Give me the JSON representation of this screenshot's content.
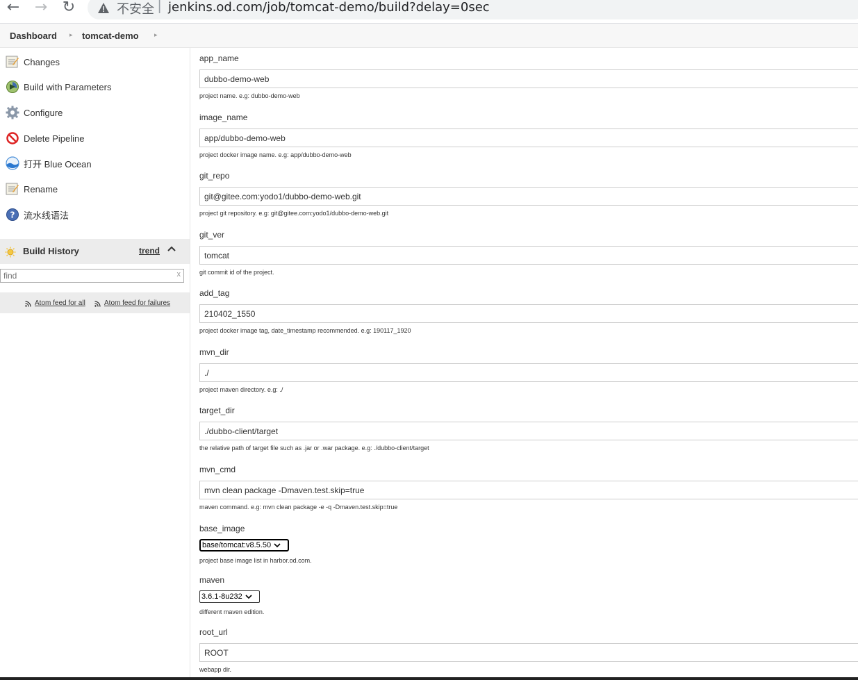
{
  "browser": {
    "insecure_label": "不安全",
    "url": "jenkins.od.com/job/tomcat-demo/build?delay=0sec"
  },
  "breadcrumb": {
    "items": [
      "Dashboard",
      "tomcat-demo"
    ]
  },
  "sidebar": {
    "tasks": [
      {
        "label": "Changes",
        "icon": "notepad-icon"
      },
      {
        "label": "Build with Parameters",
        "icon": "build-clock-icon"
      },
      {
        "label": "Configure",
        "icon": "gear-icon"
      },
      {
        "label": "Delete Pipeline",
        "icon": "no-entry-icon"
      },
      {
        "label": "打开 Blue Ocean",
        "icon": "blue-ocean-icon"
      },
      {
        "label": "Rename",
        "icon": "notepad-icon"
      },
      {
        "label": "流水线语法",
        "icon": "help-icon"
      }
    ],
    "build_history": {
      "title": "Build History",
      "trend": "trend",
      "find_placeholder": "find",
      "clear": "x",
      "feed_all": "Atom feed for all",
      "feed_failures": "Atom feed for failures"
    }
  },
  "params": [
    {
      "name": "app_name",
      "value": "dubbo-demo-web",
      "desc": "project name. e.g: dubbo-demo-web"
    },
    {
      "name": "image_name",
      "value": "app/dubbo-demo-web",
      "desc": "project docker image name. e.g: app/dubbo-demo-web"
    },
    {
      "name": "git_repo",
      "value": "git@gitee.com:yodo1/dubbo-demo-web.git",
      "desc": "project git repository. e.g: git@gitee.com:yodo1/dubbo-demo-web.git"
    },
    {
      "name": "git_ver",
      "value": "tomcat",
      "desc": "git commit id of the project."
    },
    {
      "name": "add_tag",
      "value": "210402_1550",
      "desc": "project docker image tag, date_timestamp recommended. e.g: 190117_1920"
    },
    {
      "name": "mvn_dir",
      "value": "./",
      "desc": "project maven directory. e.g: ./"
    },
    {
      "name": "target_dir",
      "value": "./dubbo-client/target",
      "desc": "the relative path of target file such as .jar or .war package. e.g: ./dubbo-client/target"
    },
    {
      "name": "mvn_cmd",
      "value": "mvn clean package -Dmaven.test.skip=true",
      "desc": "maven command. e.g: mvn clean package -e -q -Dmaven.test.skip=true"
    },
    {
      "name": "base_image",
      "value": "base/tomcat:v8.5.50",
      "desc": "project base image list in harbor.od.com."
    },
    {
      "name": "maven",
      "value": "3.6.1-8u232",
      "desc": "different maven edition."
    },
    {
      "name": "root_url",
      "value": "ROOT",
      "desc": "webapp dir."
    }
  ]
}
